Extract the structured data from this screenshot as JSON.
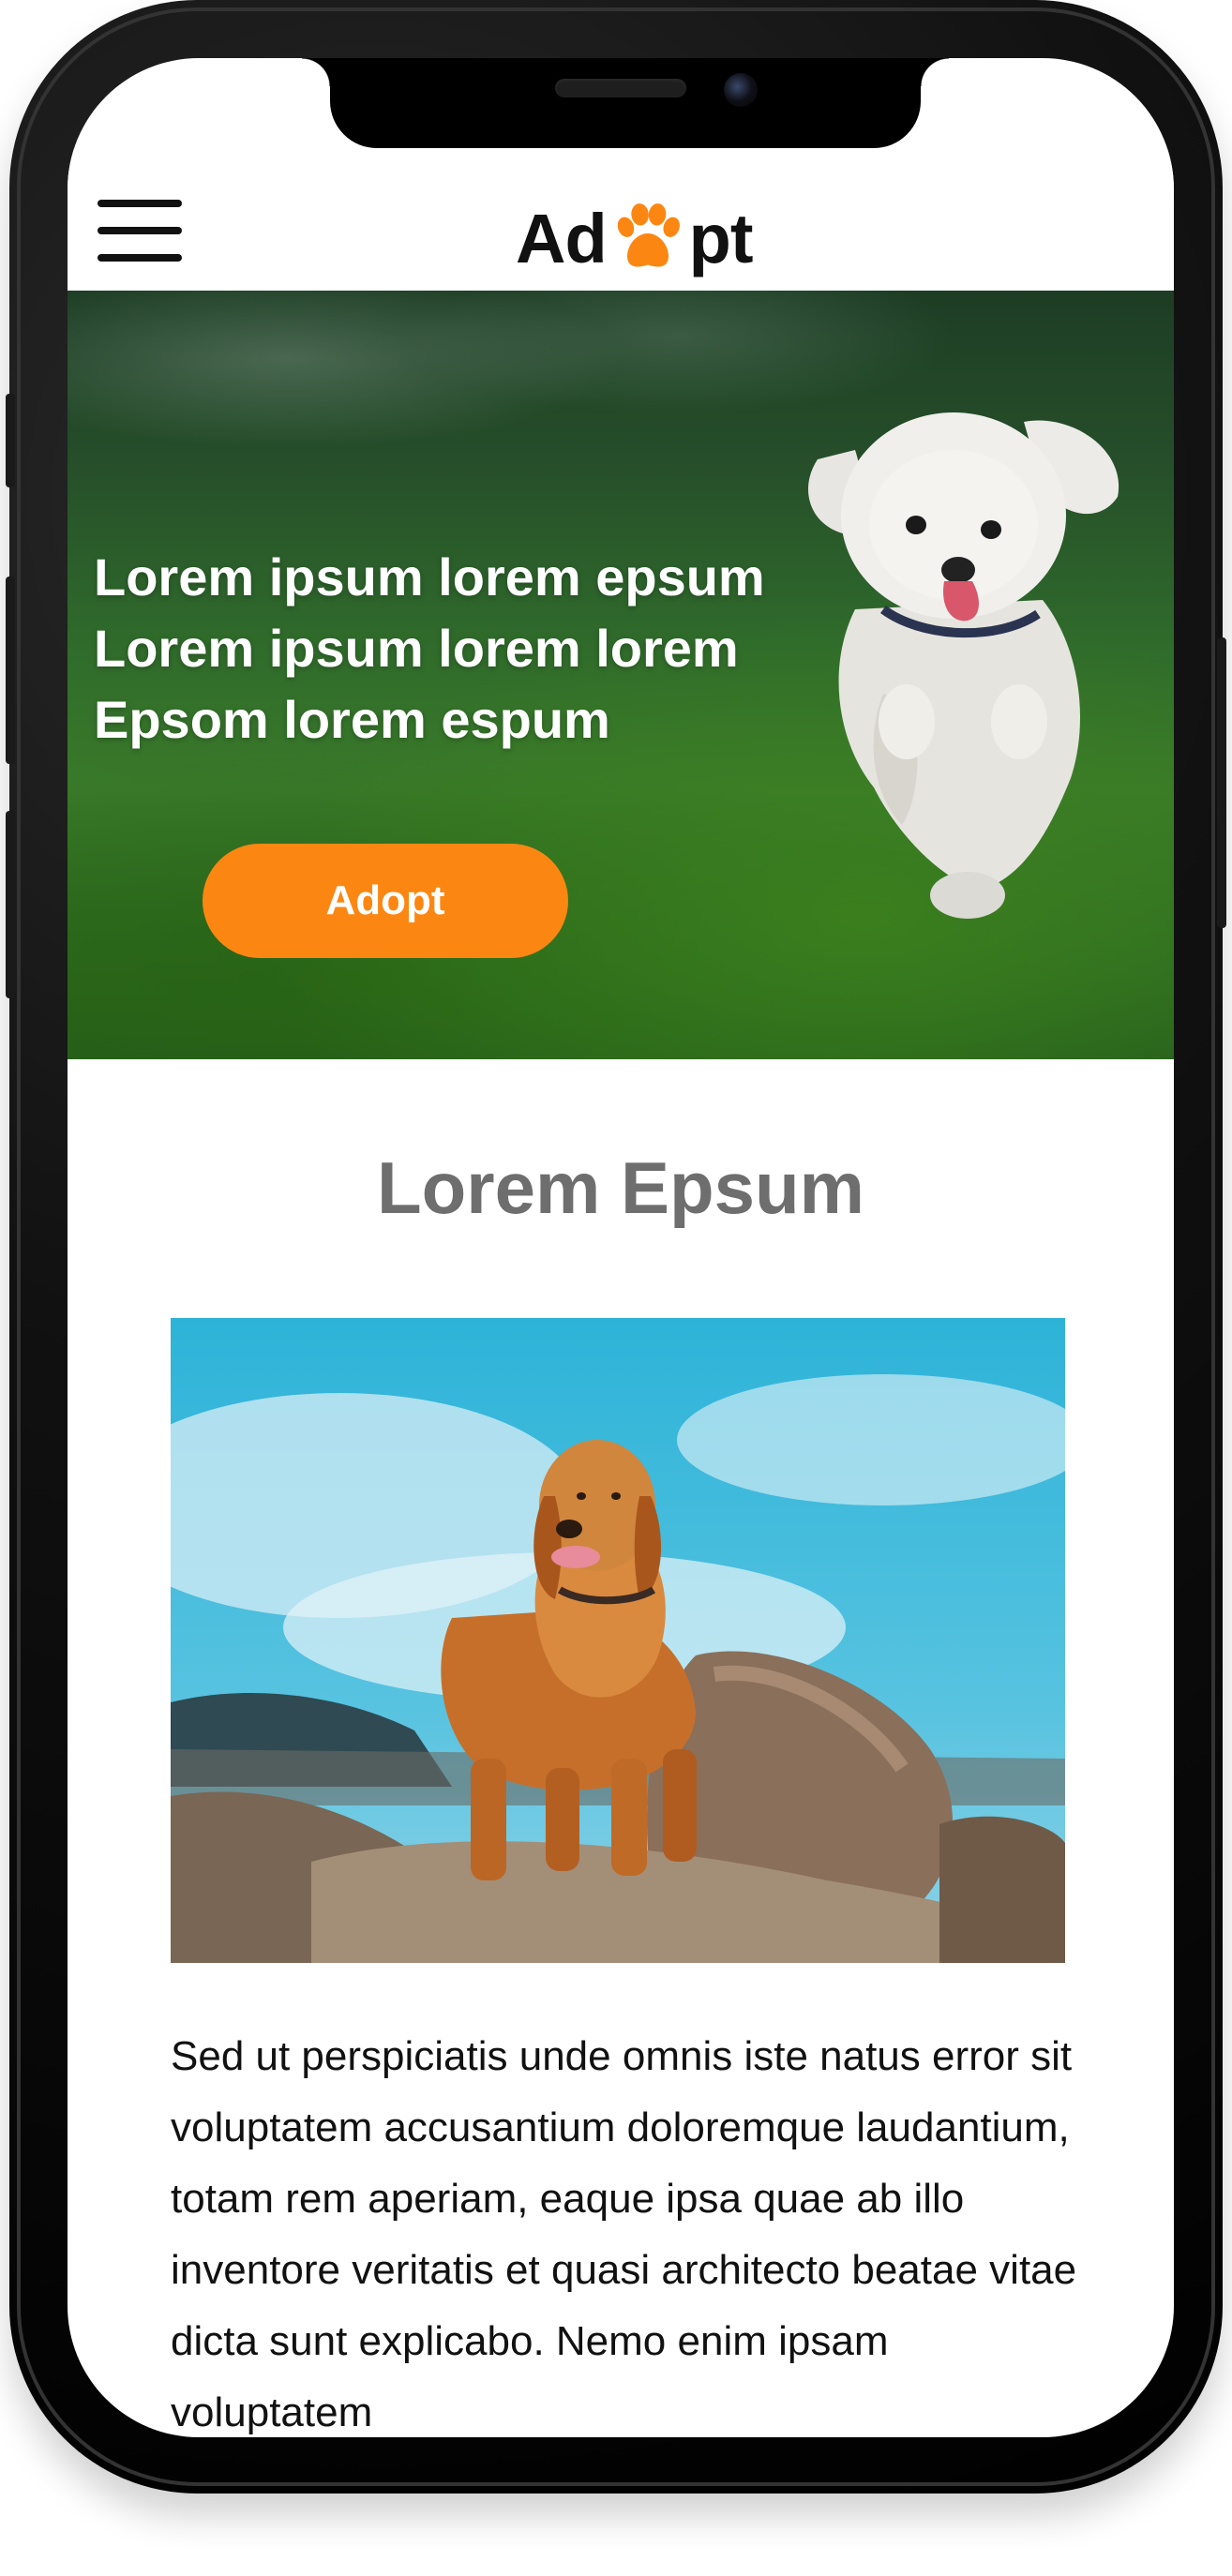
{
  "app": {
    "logo_prefix": "Ad",
    "logo_suffix": "pt",
    "logo_icon": "paw-icon",
    "menu_icon": "hamburger-menu-icon"
  },
  "hero": {
    "headline_lines": [
      "Lorem ipsum lorem epsum",
      "Lorem ipsum lorem lorem",
      "Epsom lorem espum"
    ],
    "button_label": "Adopt"
  },
  "section": {
    "title": "Lorem Epsum",
    "body": "Sed ut perspiciatis unde omnis iste natus error sit voluptatem accusantium doloremque laudantium, totam rem aperiam, eaque ipsa quae ab illo inventore veritatis et quasi architecto beatae vitae dicta sunt explicabo. Nemo enim ipsam voluptatem"
  },
  "colors": {
    "accent": "#fb8712",
    "title_gray": "#6e6e6e",
    "text": "#111111",
    "device": "#000000"
  }
}
